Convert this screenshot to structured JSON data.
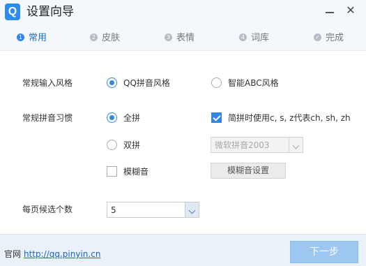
{
  "window": {
    "app_icon_text": "Q",
    "title": "设置向导",
    "minimize_label": "—",
    "close_label": "✕"
  },
  "tabs": [
    {
      "num": "1",
      "label": "常用",
      "active": true
    },
    {
      "num": "2",
      "label": "皮肤",
      "active": false
    },
    {
      "num": "3",
      "label": "表情",
      "active": false
    },
    {
      "num": "4",
      "label": "词库",
      "active": false
    },
    {
      "num": "✓",
      "label": "完成",
      "active": false
    }
  ],
  "input_style": {
    "label": "常规输入风格",
    "options": [
      {
        "label": "QQ拼音风格",
        "checked": true
      },
      {
        "label": "智能ABC风格",
        "checked": false
      }
    ]
  },
  "pinyin_habit": {
    "label": "常规拼音习惯",
    "full_pinyin": {
      "label": "全拼",
      "checked": true
    },
    "abbrev_checkbox": {
      "label": "简拼时使用c, s, z代表ch, sh, zh",
      "checked": true
    },
    "double_pinyin": {
      "label": "双拼",
      "checked": false
    },
    "double_scheme_select": {
      "value": "微软拼音2003",
      "disabled": true
    },
    "fuzzy_checkbox": {
      "label": "模糊音",
      "checked": false
    },
    "fuzzy_settings_button": "模糊音设置"
  },
  "candidates": {
    "label": "每页候选个数",
    "value": "5"
  },
  "footer": {
    "site_label": "官网",
    "site_link": "http://qq.pinyin.cn",
    "next_button": "下一步"
  },
  "colors": {
    "accent": "#2f86e8",
    "next_button_bg": "#9dc7f1",
    "footer_bg": "#eaf1f9",
    "header_bg": "#f4f7fb"
  }
}
